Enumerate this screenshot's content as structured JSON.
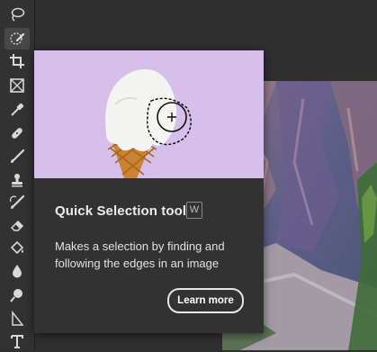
{
  "toolbar": {
    "tools": [
      {
        "name": "lasso-tool",
        "icon": "lasso-icon",
        "active": false
      },
      {
        "name": "quick-selection-tool",
        "icon": "quick-selection-brush-icon",
        "active": true
      },
      {
        "name": "crop-tool",
        "icon": "crop-icon",
        "active": false
      },
      {
        "name": "frame-tool",
        "icon": "frame-icon",
        "active": false
      },
      {
        "name": "eyedropper-tool",
        "icon": "eyedropper-icon",
        "active": false
      },
      {
        "name": "spot-healing-tool",
        "icon": "bandage-icon",
        "active": false
      },
      {
        "name": "brush-tool",
        "icon": "brush-icon",
        "active": false
      },
      {
        "name": "clone-stamp-tool",
        "icon": "stamp-icon",
        "active": false
      },
      {
        "name": "history-brush-tool",
        "icon": "history-brush-icon",
        "active": false
      },
      {
        "name": "eraser-tool",
        "icon": "eraser-icon",
        "active": false
      },
      {
        "name": "paint-bucket-tool",
        "icon": "paint-bucket-icon",
        "active": false
      },
      {
        "name": "blur-tool",
        "icon": "drop-icon",
        "active": false
      },
      {
        "name": "dodge-tool",
        "icon": "dodge-icon",
        "active": false
      },
      {
        "name": "path-selection-tool",
        "icon": "arrow-icon",
        "active": false
      },
      {
        "name": "type-tool",
        "icon": "type-icon",
        "active": false
      }
    ]
  },
  "tooltip": {
    "title": "Quick Selection tool",
    "shortcut": "W",
    "description": "Makes a selection by finding and following the edges in an image",
    "learn_more_label": "Learn more"
  },
  "colors": {
    "toolbar_bg": "#323232",
    "panel_bg": "#323232",
    "preview_bg": "#d6bfea",
    "text": "#ececec"
  }
}
